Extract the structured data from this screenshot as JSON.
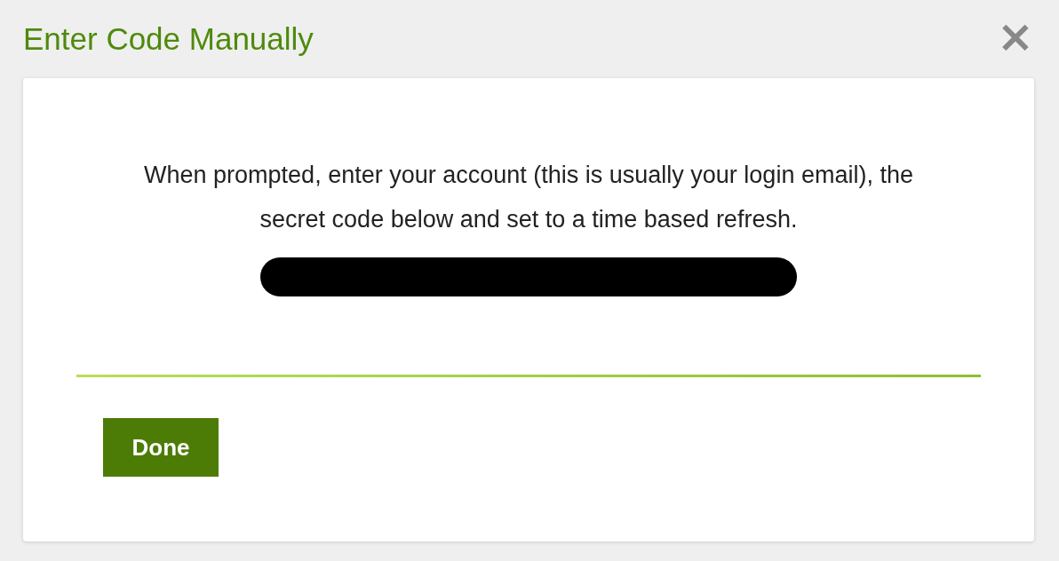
{
  "dialog": {
    "title": "Enter Code Manually",
    "close": "×"
  },
  "message": "When prompted, enter your account (this is usually your login email), the secret code below and set to a time based refresh.",
  "buttons": [
    {
      "label": "Done",
      "kind": "primary"
    }
  ]
}
